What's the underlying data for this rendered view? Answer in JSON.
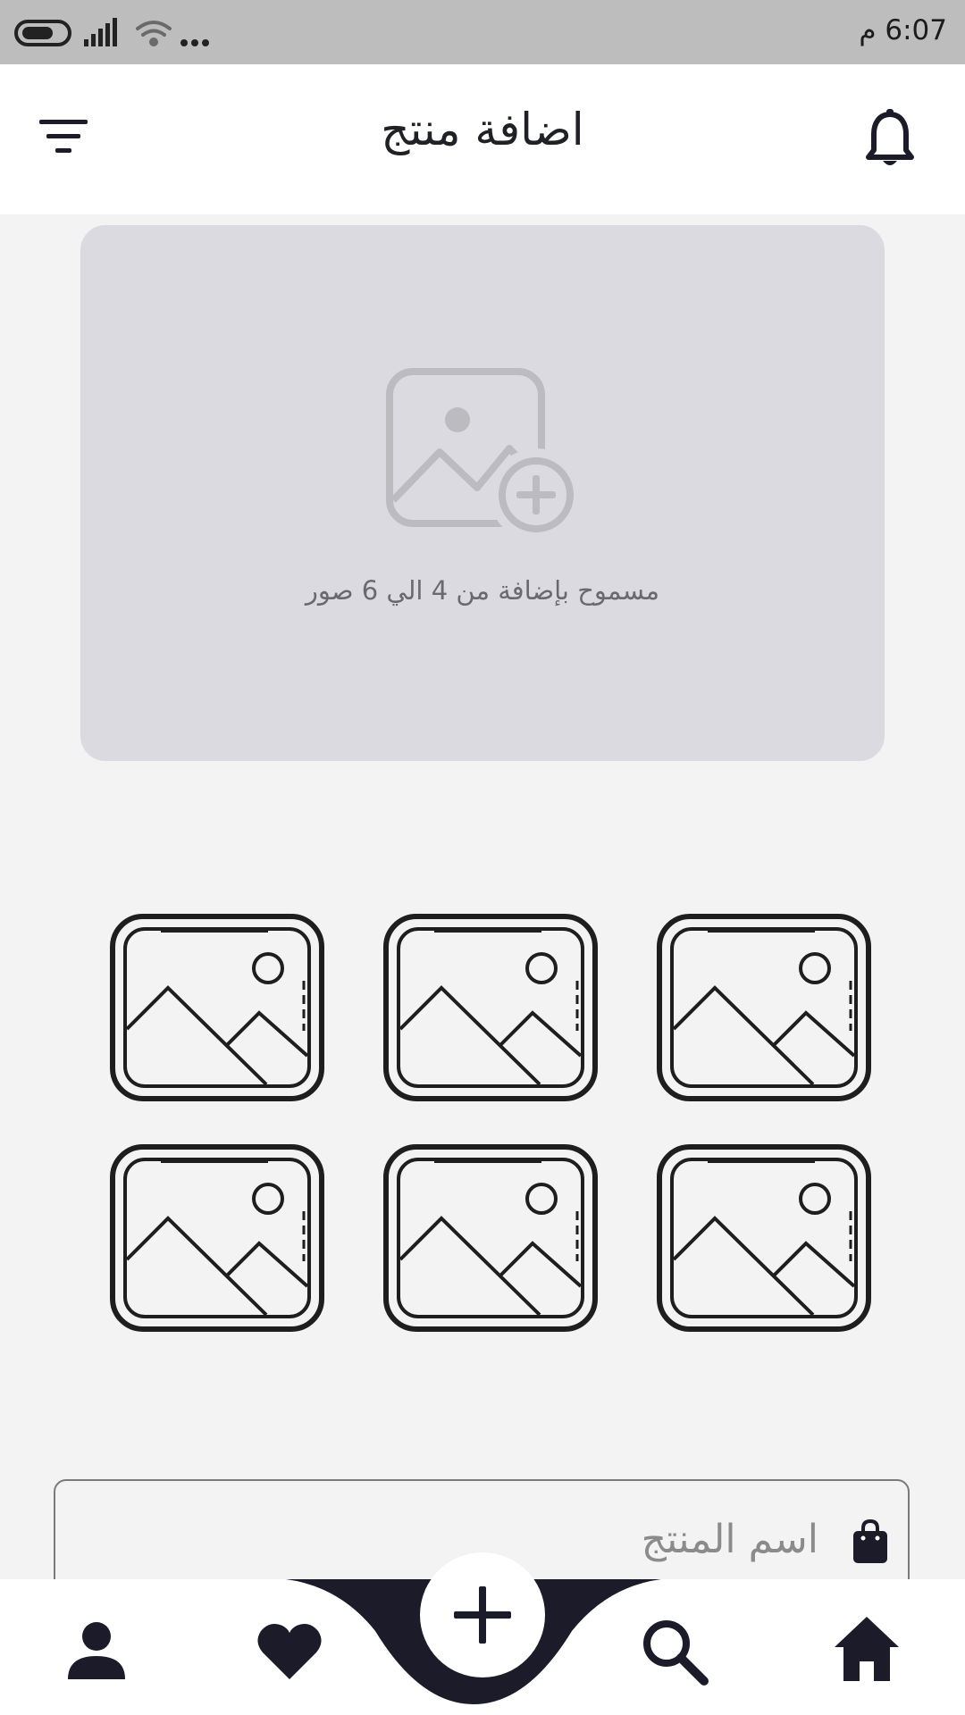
{
  "status_bar": {
    "time": "6:07 م"
  },
  "header": {
    "title": "اضافة منتج",
    "left_icon": "filter-icon",
    "right_icon": "bell-icon"
  },
  "upload": {
    "icon": "add-image-icon",
    "hint": "مسموح بإضافة من 4 الي 6 صور"
  },
  "thumbnails": [
    {
      "icon": "image-placeholder-icon"
    },
    {
      "icon": "image-placeholder-icon"
    },
    {
      "icon": "image-placeholder-icon"
    },
    {
      "icon": "image-placeholder-icon"
    },
    {
      "icon": "image-placeholder-icon"
    },
    {
      "icon": "image-placeholder-icon"
    }
  ],
  "form": {
    "product_name_placeholder": "اسم المنتج",
    "product_name_value": "",
    "field_icon": "shopping-bag-icon"
  },
  "bottom_nav": {
    "items": [
      "profile-icon",
      "heart-icon",
      "add-icon",
      "search-icon",
      "home-icon"
    ],
    "accent_color": "#1b1b2a"
  }
}
